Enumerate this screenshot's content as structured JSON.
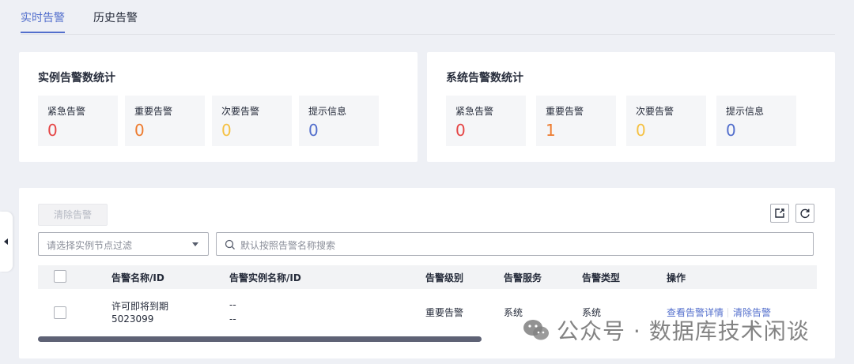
{
  "tabs": [
    {
      "label": "实时告警",
      "active": true
    },
    {
      "label": "历史告警",
      "active": false
    }
  ],
  "instance_stats": {
    "title": "实例告警数统计",
    "items": [
      {
        "label": "紧急告警",
        "value": "0",
        "color": "#e54545"
      },
      {
        "label": "重要告警",
        "value": "0",
        "color": "#ed7b2f"
      },
      {
        "label": "次要告警",
        "value": "0",
        "color": "#f5c143"
      },
      {
        "label": "提示信息",
        "value": "0",
        "color": "#526ecc"
      }
    ]
  },
  "system_stats": {
    "title": "系统告警数统计",
    "items": [
      {
        "label": "紧急告警",
        "value": "0",
        "color": "#e54545"
      },
      {
        "label": "重要告警",
        "value": "1",
        "color": "#ed7b2f"
      },
      {
        "label": "次要告警",
        "value": "0",
        "color": "#f5c143"
      },
      {
        "label": "提示信息",
        "value": "0",
        "color": "#526ecc"
      }
    ]
  },
  "toolbar": {
    "clear_label": "清除告警",
    "export_icon": "export-icon",
    "refresh_icon": "refresh-icon"
  },
  "filters": {
    "node_placeholder": "请选择实例节点过滤",
    "search_placeholder": "默认按照告警名称搜索"
  },
  "table": {
    "headers": [
      "告警名称/ID",
      "告警实例名称/ID",
      "告警级别",
      "告警服务",
      "告警类型",
      "操作"
    ],
    "rows": [
      {
        "name": "许可即将到期",
        "id": "5023099",
        "instance_name": "--",
        "instance_id": "--",
        "level": "重要告警",
        "service": "系统",
        "type": "系统",
        "actions": [
          "查看告警详情",
          "清除告警"
        ]
      }
    ]
  },
  "scroll": {
    "thumb_fraction": 0.57
  },
  "watermark": {
    "text": "公众号 · 数据库技术闲谈"
  }
}
